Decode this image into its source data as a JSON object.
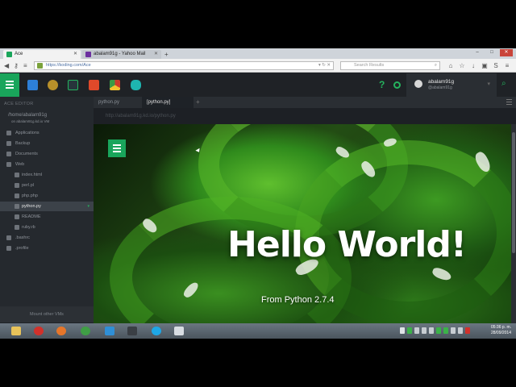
{
  "browser": {
    "tabs": [
      {
        "label": "Ace",
        "favicon_color": "#19a55b"
      },
      {
        "label": "abalam91g - Yahoo Mail",
        "favicon_color": "#6b2fa0"
      }
    ],
    "url": "https://koding.com/Ace",
    "search_placeholder": "Search Results",
    "window_controls": {
      "minimize": "–",
      "maximize": "□",
      "close": "✕"
    }
  },
  "koding": {
    "user": {
      "name": "abalam91g",
      "handle": "@abalam91g"
    },
    "help_label": "?",
    "toolbar_icons": [
      {
        "name": "chat-icon",
        "color": "#2d7fd8"
      },
      {
        "name": "bitcoin-icon",
        "color": "#b8902a"
      },
      {
        "name": "terminal-icon",
        "color": "#27343b"
      },
      {
        "name": "html5-icon",
        "color": "#e0492a"
      },
      {
        "name": "chrome-app-icon",
        "color": "#cc3b2b"
      },
      {
        "name": "hexagon-icon",
        "color": "#1eb5b0"
      }
    ]
  },
  "sidebar": {
    "title": "ACE EDITOR",
    "root_path": "/home/abalam91g",
    "root_sub": "on abalam91g.kd.io VM",
    "items": [
      {
        "label": "Applications",
        "indent": 1,
        "selected": false
      },
      {
        "label": "Backup",
        "indent": 1,
        "selected": false
      },
      {
        "label": "Documents",
        "indent": 1,
        "selected": false
      },
      {
        "label": "Web",
        "indent": 1,
        "selected": false
      },
      {
        "label": "index.html",
        "indent": 2,
        "selected": false
      },
      {
        "label": "perl.pl",
        "indent": 2,
        "selected": false
      },
      {
        "label": "php.php",
        "indent": 2,
        "selected": false
      },
      {
        "label": "python.py",
        "indent": 2,
        "selected": true
      },
      {
        "label": "README",
        "indent": 2,
        "selected": false
      },
      {
        "label": "ruby.rb",
        "indent": 2,
        "selected": false
      },
      {
        "label": ".bashrc",
        "indent": 1,
        "selected": false
      },
      {
        "label": ".profile",
        "indent": 1,
        "selected": false
      }
    ],
    "mount_label": "Mount other VMs"
  },
  "editor": {
    "tabs": [
      {
        "label": "python.py",
        "active": false
      },
      {
        "label": "[python.py]",
        "active": true
      }
    ],
    "preview_url": "http://abalam91g.kd.io/python.py"
  },
  "preview": {
    "heading": "Hello World!",
    "subtext": "From Python 2.7.4"
  },
  "taskbar": {
    "time": "05:36 p. m.",
    "date": "28/09/2014",
    "apps": [
      {
        "name": "file-explorer-icon",
        "color": "#e8c35a"
      },
      {
        "name": "opera-icon",
        "color": "#d1312b"
      },
      {
        "name": "firefox-icon",
        "color": "#e6762a"
      },
      {
        "name": "chrome-icon",
        "color": "#3f9e45"
      },
      {
        "name": "internet-explorer-icon",
        "color": "#2f8fd6"
      },
      {
        "name": "screen-capture-icon",
        "color": "#3a3f45"
      },
      {
        "name": "skype-icon",
        "color": "#1ea7e6"
      },
      {
        "name": "camera-icon",
        "color": "#d8dde2"
      }
    ]
  }
}
